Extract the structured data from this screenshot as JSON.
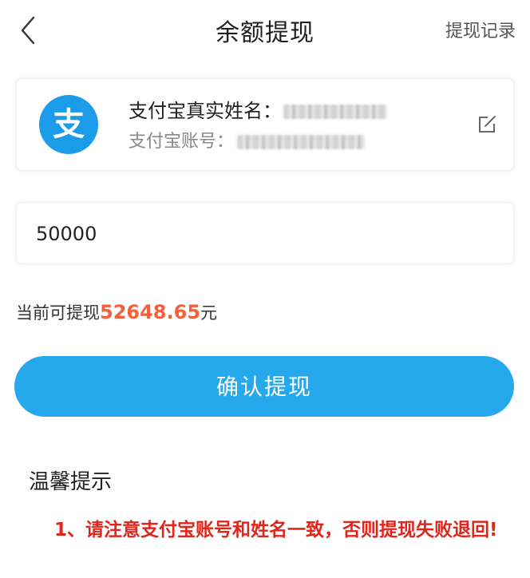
{
  "header": {
    "title": "余额提现",
    "back_icon": "chevron-left-icon",
    "record_link": "提现记录"
  },
  "account": {
    "logo_icon": "alipay-icon",
    "logo_char": "支",
    "logo_color": "#1a9ce8",
    "name_label": "支付宝真实姓名：",
    "account_label": "支付宝账号：",
    "edit_icon": "edit-icon"
  },
  "amount": {
    "value": "50000"
  },
  "balance": {
    "prefix": "当前可提现",
    "value": "52648.65",
    "unit": "元",
    "value_color": "#f5603a"
  },
  "confirm": {
    "label": "确认提现",
    "color": "#26a8ec"
  },
  "tips": {
    "title": "温馨提示",
    "items": [
      "1、请注意支付宝账号和姓名一致，否则提现失败退回!"
    ],
    "color": "#e0261c"
  }
}
